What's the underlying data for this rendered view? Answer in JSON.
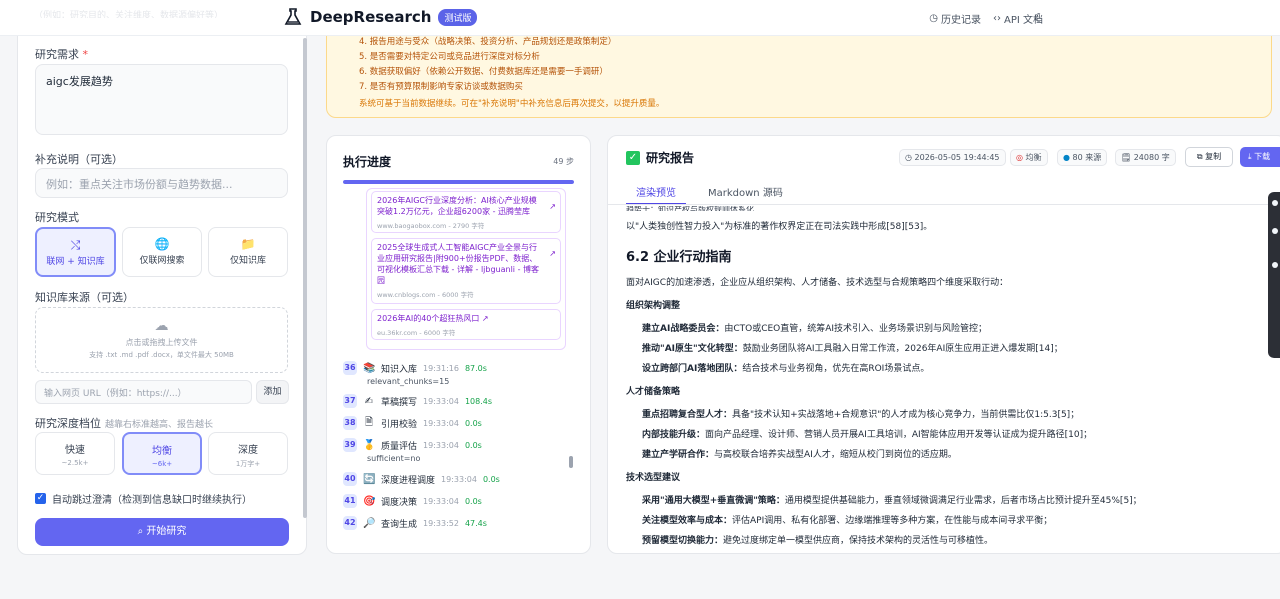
{
  "header": {
    "brand": "DeepResearch",
    "badge": "测试版",
    "history": "历史记录",
    "api_docs": "API 文档",
    "top_ghost": "（例如：研究目的、关注维度、数据源偏好等）"
  },
  "form": {
    "need_label": "研究需求",
    "need_required": "*",
    "need_value": "aigc发展趋势",
    "supplement_label": "补充说明（可选）",
    "supplement_placeholder": "例如：重点关注市场份额与趋势数据...",
    "mode_label": "研究模式",
    "modes": [
      {
        "label": "联网 + 知识库",
        "icon": "network-icon",
        "selected": true
      },
      {
        "label": "仅联网搜索",
        "icon": "globe-icon",
        "selected": false
      },
      {
        "label": "仅知识库",
        "icon": "folder-icon",
        "selected": false
      }
    ],
    "kb_label": "知识库来源（可选）",
    "upload_text": "点击或拖拽上传文件",
    "upload_hint": "支持 .txt .md .pdf .docx，单文件最大 50MB",
    "url_placeholder": "输入网页 URL（例如：https://...）",
    "add_button": "添加",
    "depth_label": "研究深度档位",
    "depth_hint": "越靠右标准越高、报告越长",
    "depths": [
      {
        "label": "快速",
        "sub": "~2.5k+",
        "selected": false
      },
      {
        "label": "均衡",
        "sub": "~6k+",
        "selected": true
      },
      {
        "label": "深度",
        "sub": "1万字+",
        "selected": false
      }
    ],
    "auto_skip_label": "自动跳过澄清（检测到信息缺口时继续执行）",
    "auto_skip_checked": true,
    "start_button": "开始研究"
  },
  "clarify": {
    "items": [
      "4.  报告用途与受众（战略决策、投资分析、产品规划还是政策制定）",
      "5.  是否需要对特定公司或竞品进行深度对标分析",
      "6.  数据获取偏好（依赖公开数据、付费数据库还是需要一手调研）",
      "7.  是否有预算限制影响专家访谈或数据购买"
    ],
    "note": "系统可基于当前数据继续。可在\"补充说明\"中补充信息后再次提交，以提升质量。"
  },
  "progress": {
    "title": "执行进度",
    "steps_count": "49 步",
    "fraction": 1.0,
    "links": [
      {
        "title": "2026年AIGC行业深度分析：AI核心产业规模突破1.2万亿元，企业超6200家 - 迅腾莹库",
        "source": "www.baogaobox.com - 2790 字符"
      },
      {
        "title": "2025全球生成式人工智能AIGC产业全景与行业应用研究报告|附900+份报告PDF、数据、可视化模板汇总下载 - 详解 - ljbguanli - 博客园",
        "source": "www.cnblogs.com - 6000 字符"
      },
      {
        "title": "2026年AI的40个超狂热风口",
        "source": "eu.36kr.com - 6000 字符"
      }
    ],
    "steps": [
      {
        "n": "36",
        "icon": "📚",
        "name": "知识入库",
        "time": "19:31:16",
        "dur": "87.0s",
        "sub": "relevant_chunks=15"
      },
      {
        "n": "37",
        "icon": "✍",
        "name": "草稿撰写",
        "time": "19:33:04",
        "dur": "108.4s",
        "sub": ""
      },
      {
        "n": "38",
        "icon": "🗎",
        "name": "引用校验",
        "time": "19:33:04",
        "dur": "0.0s",
        "sub": ""
      },
      {
        "n": "39",
        "icon": "🥇",
        "name": "质量评估",
        "time": "19:33:04",
        "dur": "0.0s",
        "sub": "sufficient=no"
      },
      {
        "n": "40",
        "icon": "🔄",
        "name": "深度进程调度",
        "time": "19:33:04",
        "dur": "0.0s",
        "sub": ""
      },
      {
        "n": "41",
        "icon": "🎯",
        "name": "调度决策",
        "time": "19:33:04",
        "dur": "0.0s",
        "sub": ""
      },
      {
        "n": "42",
        "icon": "🔎",
        "name": "查询生成",
        "time": "19:33:52",
        "dur": "47.4s",
        "sub": ""
      }
    ]
  },
  "report": {
    "title": "研究报告",
    "date": "2026-05-05 19:44:45",
    "level": "均衡",
    "sources": "80 来源",
    "words": "24080 字",
    "copy": "复制",
    "download": "下载",
    "tab_preview": "渲染预览",
    "tab_markdown": "Markdown 源码",
    "ghost_line": "趋势十：知识产权与版权规则体系化",
    "line0": "以\"人类独创性智力投入\"为标准的著作权界定正在司法实践中形成[58][53]。",
    "h2": "6.2 企业行动指南",
    "intro": "面对AIGC的加速渗透，企业应从组织架构、人才储备、技术选型与合规策略四个维度采取行动：",
    "sections": [
      {
        "title": "组织架构调整",
        "items": [
          {
            "k": "建立AI战略委员会：",
            "v": "由CTO或CEO直管，统筹AI技术引入、业务场景识别与风险管控；"
          },
          {
            "k": "推动\"AI原生\"文化转型：",
            "v": "鼓励业务团队将AI工具融入日常工作流，2026年AI原生应用正进入爆发期[14]；"
          },
          {
            "k": "设立跨部门AI落地团队：",
            "v": "结合技术与业务视角，优先在高ROI场景试点。"
          }
        ]
      },
      {
        "title": "人才储备策略",
        "items": [
          {
            "k": "重点招聘复合型人才：",
            "v": "具备\"技术认知+实战落地+合规意识\"的人才成为核心竞争力，当前供需比仅1:5.3[5]；"
          },
          {
            "k": "内部技能升级：",
            "v": "面向产品经理、设计师、营销人员开展AI工具培训，AI智能体应用开发等认证成为提升路径[10]；"
          },
          {
            "k": "建立产学研合作：",
            "v": "与高校联合培养实战型AI人才，缩短从校门到岗位的适应期。"
          }
        ]
      },
      {
        "title": "技术选型建议",
        "items": [
          {
            "k": "采用\"通用大模型+垂直微调\"策略：",
            "v": "通用模型提供基础能力，垂直领域微调满足行业需求，后者市场占比预计提升至45%[5]；"
          },
          {
            "k": "关注模型效率与成本：",
            "v": "评估API调用、私有化部署、边缘端推理等多种方案，在性能与成本间寻求平衡；"
          },
          {
            "k": "预留模型切换能力：",
            "v": "避免过度绑定单一模型供应商，保持技术架构的灵活性与可移植性。"
          }
        ]
      }
    ]
  }
}
